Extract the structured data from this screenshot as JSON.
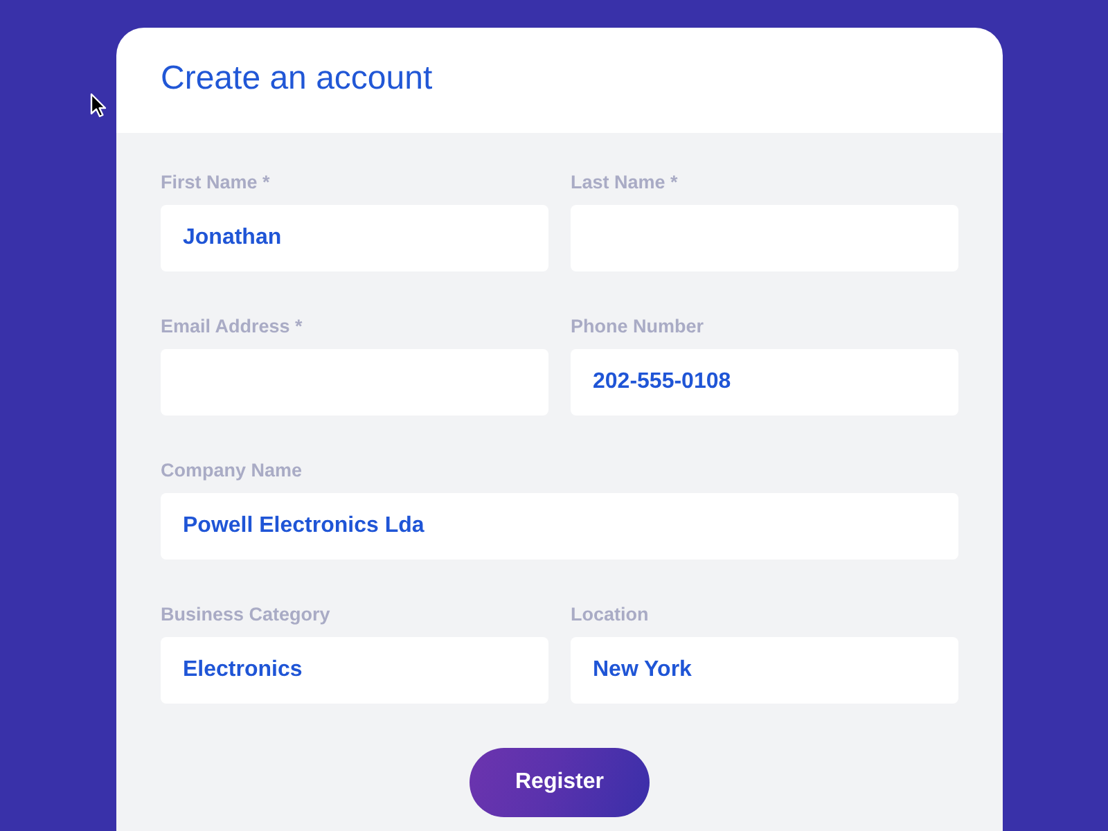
{
  "card": {
    "title": "Create an account"
  },
  "form_rows": [
    [
      {
        "label": "First Name *",
        "value": "Jonathan"
      },
      {
        "label": "Last Name *"
      }
    ],
    [
      {
        "label": "Email Address *"
      },
      {
        "label": "Phone Number",
        "value": "202-555-0108"
      }
    ],
    [
      {
        "label": "Company Name",
        "value": "Powell Electronics Lda"
      }
    ],
    [
      {
        "label": "Business Category",
        "value": "Electronics"
      },
      {
        "label": "Location",
        "value": "New York"
      }
    ]
  ],
  "submit_button": {
    "label": "Register"
  }
}
